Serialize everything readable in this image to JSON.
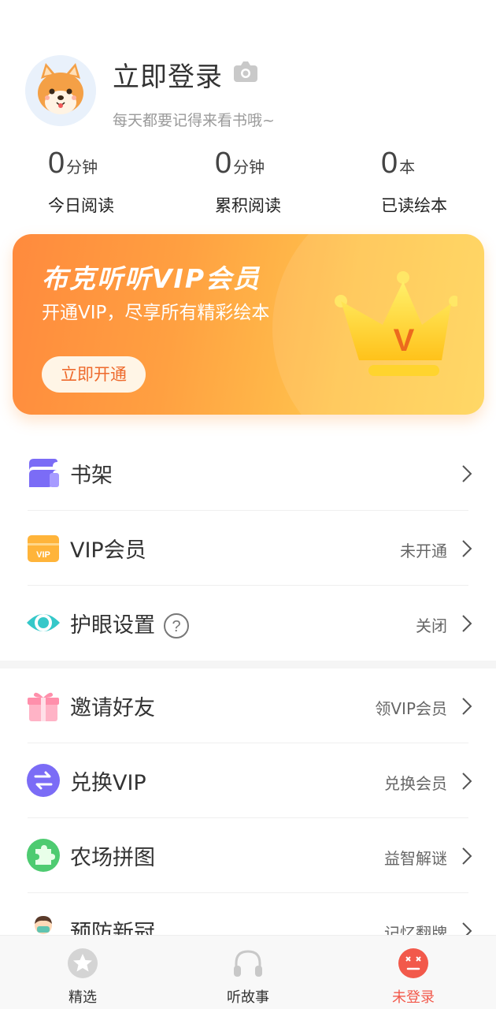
{
  "profile": {
    "login_title": "立即登录",
    "subtitle": "每天都要记得来看书哦~"
  },
  "stats": [
    {
      "value": "0",
      "unit": "分钟",
      "label": "今日阅读"
    },
    {
      "value": "0",
      "unit": "分钟",
      "label": "累积阅读"
    },
    {
      "value": "0",
      "unit": "本",
      "label": "已读绘本"
    }
  ],
  "vip_banner": {
    "title": "布克听听VIP会员",
    "subtitle": "开通VIP，尽享所有精彩绘本",
    "button": "立即开通",
    "crown_letter": "V"
  },
  "menu": [
    {
      "label": "书架",
      "value": "",
      "icon": "bookshelf-icon"
    },
    {
      "label": "VIP会员",
      "value": "未开通",
      "icon": "vip-card-icon"
    },
    {
      "label": "护眼设置",
      "value": "关闭",
      "icon": "eye-icon"
    },
    {
      "label": "邀请好友",
      "value": "领VIP会员",
      "icon": "gift-icon"
    },
    {
      "label": "兑换VIP",
      "value": "兑换会员",
      "icon": "exchange-icon"
    },
    {
      "label": "农场拼图",
      "value": "益智解谜",
      "icon": "puzzle-icon"
    },
    {
      "label": "预防新冠",
      "value": "记忆翻牌",
      "icon": "doctor-icon"
    }
  ],
  "tabs": [
    {
      "label": "精选",
      "icon": "star-icon"
    },
    {
      "label": "听故事",
      "icon": "headphones-icon"
    },
    {
      "label": "未登录",
      "icon": "user-face-icon"
    }
  ],
  "colors": {
    "accent": "#f2594b",
    "vip_start": "#ff8a3d",
    "vip_end": "#ffd455"
  }
}
